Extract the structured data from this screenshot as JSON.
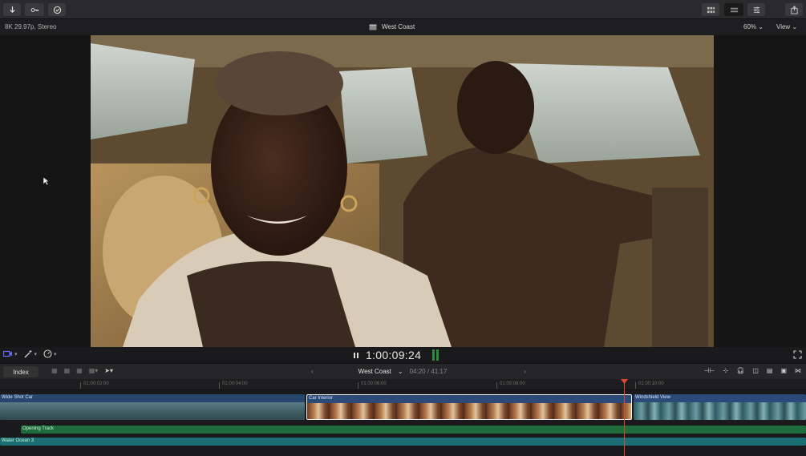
{
  "toolbar": {
    "left_buttons": [
      "import-icon",
      "keyword-icon",
      "background-tasks-icon"
    ],
    "right_buttons": [
      "browser-layout-icon",
      "timeline-layout-icon",
      "inspector-icon",
      "share-icon"
    ]
  },
  "viewer": {
    "format": "8K 29.97p, Stereo",
    "title": "West Coast",
    "zoom": "60%",
    "view_menu": "View"
  },
  "transport": {
    "timecode": "1:00:09:24"
  },
  "timeline": {
    "index_label": "Index",
    "project_name": "West Coast",
    "duration": "04:20 / 41:17",
    "ruler_ticks": [
      "01:00:02:00",
      "01:00:04:00",
      "01:00:06:00",
      "01:00:08:00",
      "01:00:10:00"
    ],
    "clips": [
      {
        "label": "Wide Shot Car"
      },
      {
        "label": "Car Interior"
      },
      {
        "label": "Windshield View"
      }
    ],
    "audio_tracks": [
      {
        "label": "Opening Track"
      },
      {
        "label": "Water Ocean 3"
      }
    ]
  },
  "colors": {
    "playhead": "#e0492c",
    "video_clip": "#2c4a78",
    "audio_music": "#1f6b3a",
    "audio_fx": "#1b6e73"
  }
}
